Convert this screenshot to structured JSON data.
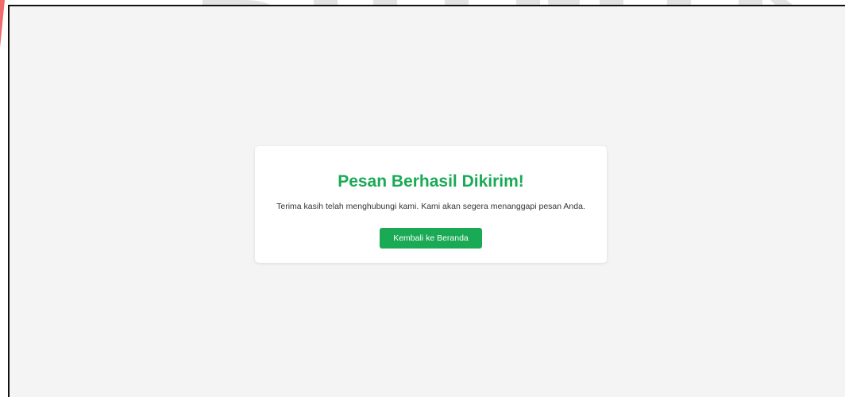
{
  "success_card": {
    "title": "Pesan Berhasil Dikirim!",
    "message": "Terima kasih telah menghubungi kami. Kami akan segera menanggapi pesan Anda.",
    "home_button_label": "Kembali ke Beranda"
  },
  "colors": {
    "accent": "#1aaa55",
    "background": "#f4f4f4",
    "card": "#ffffff",
    "text": "#333333",
    "watermark": "#e6e6e6",
    "stripe": "#f26a6a"
  }
}
